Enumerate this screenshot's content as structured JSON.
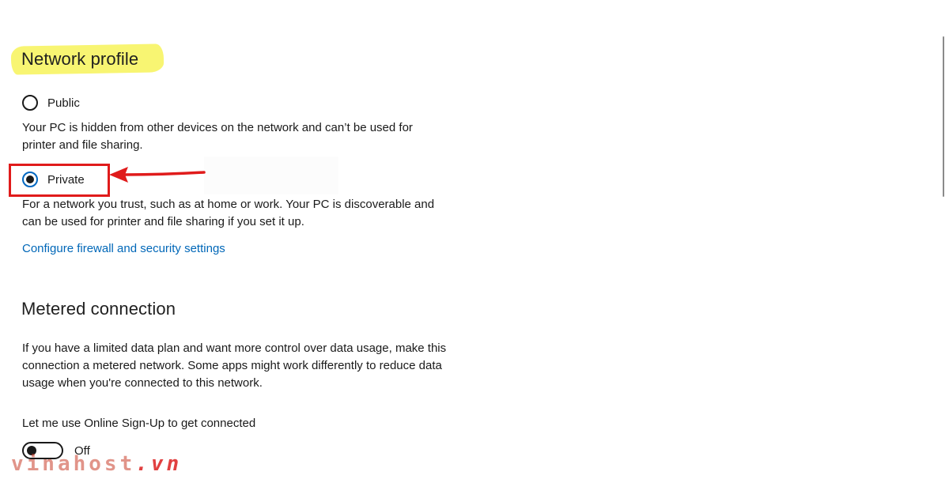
{
  "network_profile": {
    "heading": "Network profile",
    "options": [
      {
        "label": "Public",
        "checked": false,
        "description": "Your PC is hidden from other devices on the network and can’t be used for printer and file sharing."
      },
      {
        "label": "Private",
        "checked": true,
        "description": "For a network you trust, such as at home or work. Your PC is discoverable and can be used for printer and file sharing if you set it up."
      }
    ],
    "firewall_link": "Configure firewall and security settings"
  },
  "metered": {
    "heading": "Metered connection",
    "description": "If you have a limited data plan and want more control over data usage, make this connection a metered network. Some apps might work differently to reduce data usage when you're connected to this network.",
    "signup_label": "Let me use Online Sign-Up to get connected",
    "toggle_state": "Off",
    "toggle_on": false
  },
  "watermark": {
    "text": "vinahost",
    "suffix": ".vn"
  },
  "colors": {
    "link": "#0067b8",
    "annotation": "#e01b1b",
    "highlight": "#f8f572"
  },
  "icons": {
    "annotation_arrow": "arrow-left-icon"
  }
}
